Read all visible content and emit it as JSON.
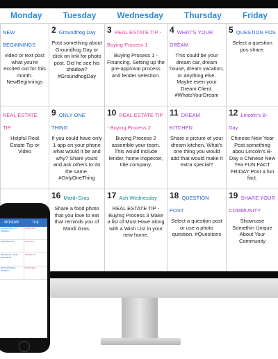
{
  "calendar": {
    "days": [
      "Monday",
      "Tuesday",
      "Wednesday",
      "Thursday",
      "Friday"
    ],
    "weeks": [
      [
        {
          "num": "",
          "tag": "NEW BEGINNINGS",
          "body": "video or text post what you're excited out for this month. NewBeginnings"
        },
        {
          "num": "2",
          "tag": "Groundhog Day",
          "body": "Post something about Groundhog Day or click on link for photo post. Did he see his shadow? #GroundhogDay"
        },
        {
          "num": "3",
          "tag": "REAL ESTATE TIP - Buying Process 1",
          "body": "Buying Process 1 - Financing.  Setting up the pre-approval process and lender selection."
        },
        {
          "num": "4",
          "tag": "WHAT'S YOUR DREAM",
          "body": "This could be your dream car, dream house, dream vacation, or anything else. Maybe even your Dream Client. #WhatsYourDream"
        },
        {
          "num": "5",
          "tag": "QUESTION POS",
          "body": "Select a question pos share."
        }
      ],
      [
        {
          "num": "",
          "tag": "REAL ESTATE TIP",
          "body": "Helpful Real Estate Tip or Video"
        },
        {
          "num": "9",
          "tag": "ONLY ONE THING",
          "body": "If you could have only 1 app on your phone what would it be and why? Share yours and ask others to do the same. #OnlyOneThing"
        },
        {
          "num": "10",
          "tag": "REAL ESTATE TIP - Buying Process 2",
          "body": "Buying Process 2 assemble your team. This would include lender, home inspector, title company."
        },
        {
          "num": "11",
          "tag": "DREAM KITCHEN",
          "body": "Share a picture of your dream kitchen.  What's one thing you would add that would make it extra special?"
        },
        {
          "num": "12",
          "tag": "Lincoln's B-Day",
          "body": "Chinese New Year Post something abou Lincoln's B-Day o Chinese New Yea FUN FACT FRIDAY Post a fun fact."
        }
      ],
      [
        {
          "num": "",
          "tag": "",
          "body": ""
        },
        {
          "num": "16",
          "tag": "Mardi Gras",
          "body": "Share a food photo that you love to eat that reminds you of Mardi Gras."
        },
        {
          "num": "17",
          "tag": "Ash Wednesday",
          "body": "REAL ESTATE TIP - Buying Process 3 Make a list of Must Have along with a Wish List in your new home."
        },
        {
          "num": "18",
          "tag": "QUESTION POST",
          "body": "Select a question post or use a photo question. #Questions"
        },
        {
          "num": "19",
          "tag": "SHARE YOUR COMMUNITY",
          "body": "Showcase Somethin Unique About Your Community"
        }
      ]
    ]
  },
  "phone": {
    "headers": [
      "MONDAY",
      "TUE"
    ],
    "rows": [
      {
        "c1": "SHARE WHO IT'S MONDAY",
        "c2": "QUESTION"
      },
      {
        "c1": "INSPIRATION",
        "c2": "Click here"
      },
      {
        "c1": "PROMOTE YOUR BUSINESS",
        "c2": "TRAVEL TU"
      },
      {
        "c1": "MOTIVATIONAL MONDAY",
        "c2": "QUESTION"
      }
    ]
  }
}
